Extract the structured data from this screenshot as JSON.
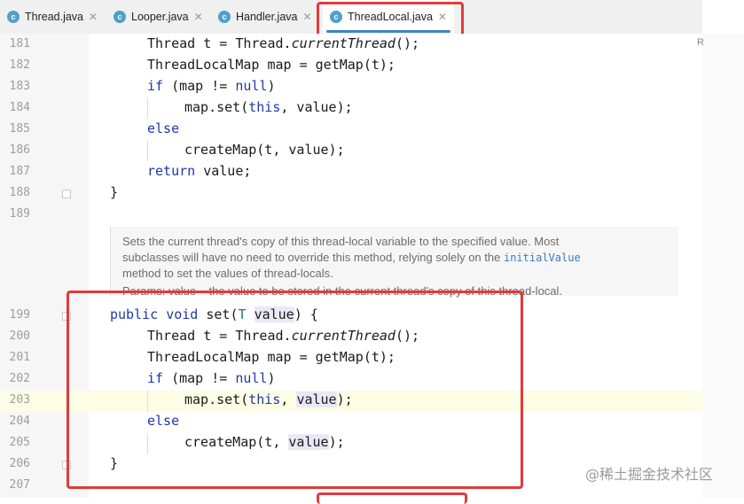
{
  "tabs": [
    {
      "label": "Thread.java",
      "icon": "c-class-icon"
    },
    {
      "label": "Looper.java",
      "icon": "c-class-icon"
    },
    {
      "label": "Handler.java",
      "icon": "c-class-icon"
    },
    {
      "label": "ThreadLocal.java",
      "icon": "c-class-icon",
      "active": true
    }
  ],
  "lines_top": [
    "181",
    "182",
    "183",
    "184",
    "185",
    "186",
    "187",
    "188",
    "189"
  ],
  "lines_bottom": [
    "199",
    "200",
    "201",
    "202",
    "203",
    "204",
    "205",
    "206",
    "207"
  ],
  "code_top": {
    "l181": {
      "a": "Thread t = Thread.",
      "b": "currentThread",
      "c": "();"
    },
    "l182": "ThreadLocalMap map = getMap(t);",
    "l183": {
      "kw": "if",
      "a": " (map != ",
      "null": "null",
      "b": ")"
    },
    "l184": {
      "a": "map.set(",
      "kw": "this",
      "b": ", value);"
    },
    "l185": "else",
    "l186": "createMap(t, value);",
    "l187": {
      "kw": "return",
      "a": " value;"
    },
    "l188": "}"
  },
  "javadoc": {
    "p1": "Sets the current thread's copy of this thread-local variable to the specified value. Most",
    "p2": "subclasses will have no need to override this method, relying solely on the",
    "p2_code": "initialValue",
    "p3": "method to set the values of thread-locals.",
    "p4": "Params: value – the value to be stored in the current thread's copy of this thread-local."
  },
  "code_bottom": {
    "l199": {
      "kw1": "public",
      "kw2": "void",
      "name": " set(",
      "type": "T",
      "param": "value",
      "end": ") {"
    },
    "l200": {
      "a": "Thread t = Thread.",
      "b": "currentThread",
      "c": "();"
    },
    "l201": "ThreadLocalMap map = getMap(t);",
    "l202": {
      "kw": "if",
      "a": " (map != ",
      "null": "null",
      "b": ")"
    },
    "l203": {
      "a": "map.set(",
      "kw": "this",
      "b": ", ",
      "param": "value",
      "c": ");"
    },
    "l204": "else",
    "l205": {
      "a": "createMap(t, ",
      "param": "value",
      "b": ");"
    },
    "l206": "}"
  },
  "right_marker": "R",
  "watermark": "@稀土掘金技术社区",
  "colors": {
    "keyword": "#1f38a8",
    "highlight": "#e23a3a",
    "accent": "#3d82c4"
  }
}
